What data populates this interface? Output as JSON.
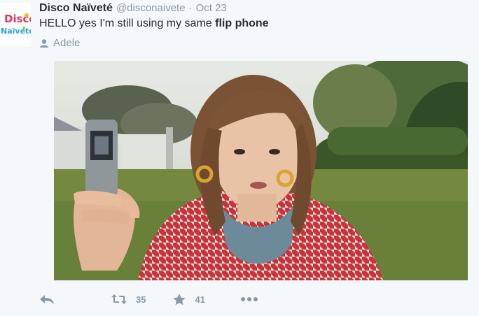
{
  "tweet": {
    "author": {
      "avatar_text_line1": "Disco",
      "avatar_text_line2": "Naïveté",
      "name": "Disco Naïveté",
      "handle": "@disconaivete",
      "separator": "·"
    },
    "timestamp": "Oct 23",
    "text": {
      "prefix": "HELLO yes I'm still using my same ",
      "bold": "flip phone"
    },
    "tagged_user": "Adele",
    "media": {
      "description_icon": "photo"
    },
    "actions": {
      "reply_icon": "reply-icon",
      "retweet_icon": "retweet-icon",
      "retweet_count": "35",
      "favorite_icon": "star-icon",
      "favorite_count": "41",
      "more_icon": "more-icon"
    }
  },
  "colors": {
    "name": "#292f33",
    "meta": "#8899a6",
    "background": "#f5f8fa"
  }
}
